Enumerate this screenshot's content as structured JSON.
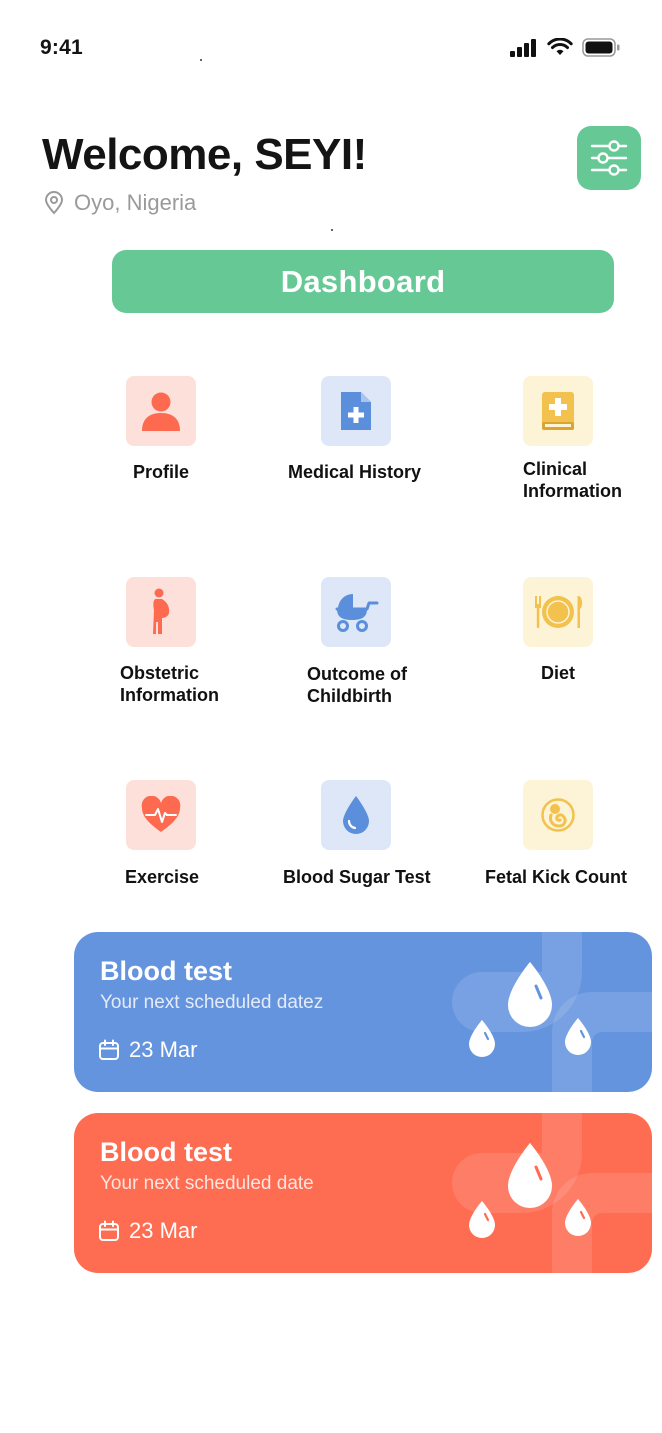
{
  "status_bar": {
    "time": "9:41"
  },
  "header": {
    "welcome": "Welcome, SEYI!",
    "location": "Oyo, Nigeria",
    "filter_icon": "sliders-icon"
  },
  "dashboard": {
    "label": "Dashboard"
  },
  "menu": [
    {
      "label": "Profile",
      "icon": "person-icon",
      "color": "#fd6a50"
    },
    {
      "label": "Medical History",
      "icon": "medical-document-icon",
      "color": "#5b8fdc"
    },
    {
      "label": "Clinical Information",
      "icon": "clinical-book-icon",
      "color": "#f2c14e"
    },
    {
      "label": "Obstetric Information",
      "icon": "pregnant-woman-icon",
      "color": "#fd6a50"
    },
    {
      "label": "Outcome of Childbirth",
      "icon": "baby-stroller-icon",
      "color": "#5b8fdc"
    },
    {
      "label": "Diet",
      "icon": "plate-cutlery-icon",
      "color": "#f2c14e"
    },
    {
      "label": "Exercise",
      "icon": "heartbeat-icon",
      "color": "#fd6a50"
    },
    {
      "label": "Blood Sugar Test",
      "icon": "blood-drop-icon",
      "color": "#5b8fdc"
    },
    {
      "label": "Fetal Kick Count",
      "icon": "fetus-icon",
      "color": "#f2c14e"
    }
  ],
  "cards": [
    {
      "title": "Blood test",
      "subtitle": "Your next scheduled datez",
      "date": "23 Mar",
      "color": "#6594df"
    },
    {
      "title": "Blood test",
      "subtitle": "Your next scheduled date",
      "date": "23 Mar",
      "color": "#fe6c52"
    }
  ],
  "colors": {
    "accent_green": "#66c995",
    "red": "#fd6a50",
    "blue": "#5b8fdc",
    "yellow": "#f2c14e"
  }
}
